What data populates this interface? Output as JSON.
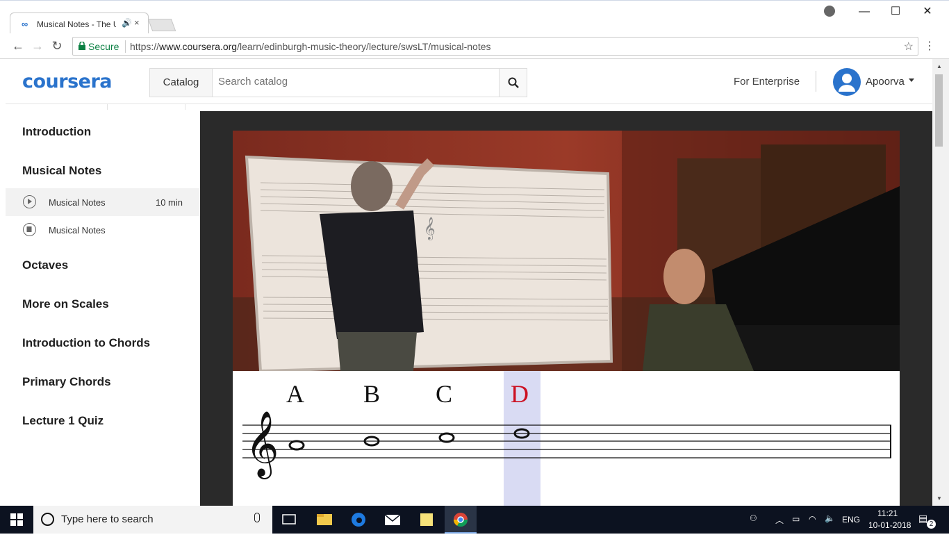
{
  "browser": {
    "tab_title": "Musical Notes - The U",
    "tab_favicon": "∞",
    "tab_audio_icon": "🔊",
    "tab_close": "×",
    "secure_label": "Secure",
    "url_scheme": "https://",
    "url_host": "www.coursera.org",
    "url_path": "/learn/edinburgh-music-theory/lecture/swsLT/musical-notes",
    "window_controls": {
      "minimize": "—",
      "maximize": "☐",
      "close": "✕"
    }
  },
  "header": {
    "logo": "coursera",
    "catalog_label": "Catalog",
    "search_placeholder": "Search catalog",
    "enterprise_label": "For Enterprise",
    "user_name": "Apoorva"
  },
  "sidebar": {
    "lessons": [
      {
        "label": "Introduction"
      },
      {
        "label": "Musical Notes"
      },
      {
        "label": "Octaves"
      },
      {
        "label": "More on Scales"
      },
      {
        "label": "Introduction to Chords"
      },
      {
        "label": "Primary Chords"
      },
      {
        "label": "Lecture 1 Quiz"
      }
    ],
    "items": [
      {
        "label": "Musical Notes",
        "duration": "10 min",
        "icon": "play-icon",
        "active": true
      },
      {
        "label": "Musical Notes",
        "duration": "",
        "icon": "reading-icon",
        "active": false
      }
    ]
  },
  "video": {
    "note_letters": [
      "A",
      "B",
      "C",
      "D"
    ],
    "highlight_letter": "D",
    "highlight_color": "#cc1122"
  },
  "taskbar": {
    "search_text": "Type here to search",
    "language": "ENG",
    "time": "11:21",
    "date": "10-01-2018",
    "notification_count": "2"
  },
  "colors": {
    "brand": "#2a73cc",
    "secure_green": "#0b8043"
  }
}
